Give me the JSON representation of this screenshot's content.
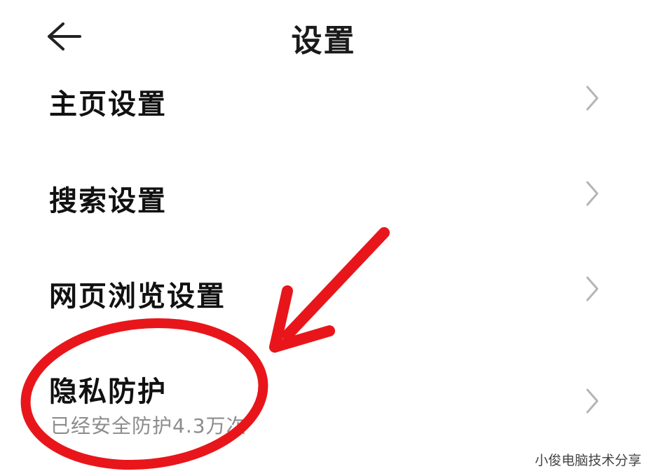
{
  "header": {
    "title": "设置",
    "back_icon": "arrow-left-icon"
  },
  "settings": {
    "items": [
      {
        "label": "主页设置"
      },
      {
        "label": "搜索设置"
      },
      {
        "label": "网页浏览设置"
      },
      {
        "label": "隐私防护",
        "subtitle": "已经安全防护4.3万次"
      }
    ],
    "chevron_icon": "chevron-right-icon"
  },
  "annotation": {
    "color": "#e8161b",
    "shapes": [
      "arrow",
      "ellipse"
    ]
  },
  "watermark": {
    "text": "小俊电脑技术分享"
  }
}
